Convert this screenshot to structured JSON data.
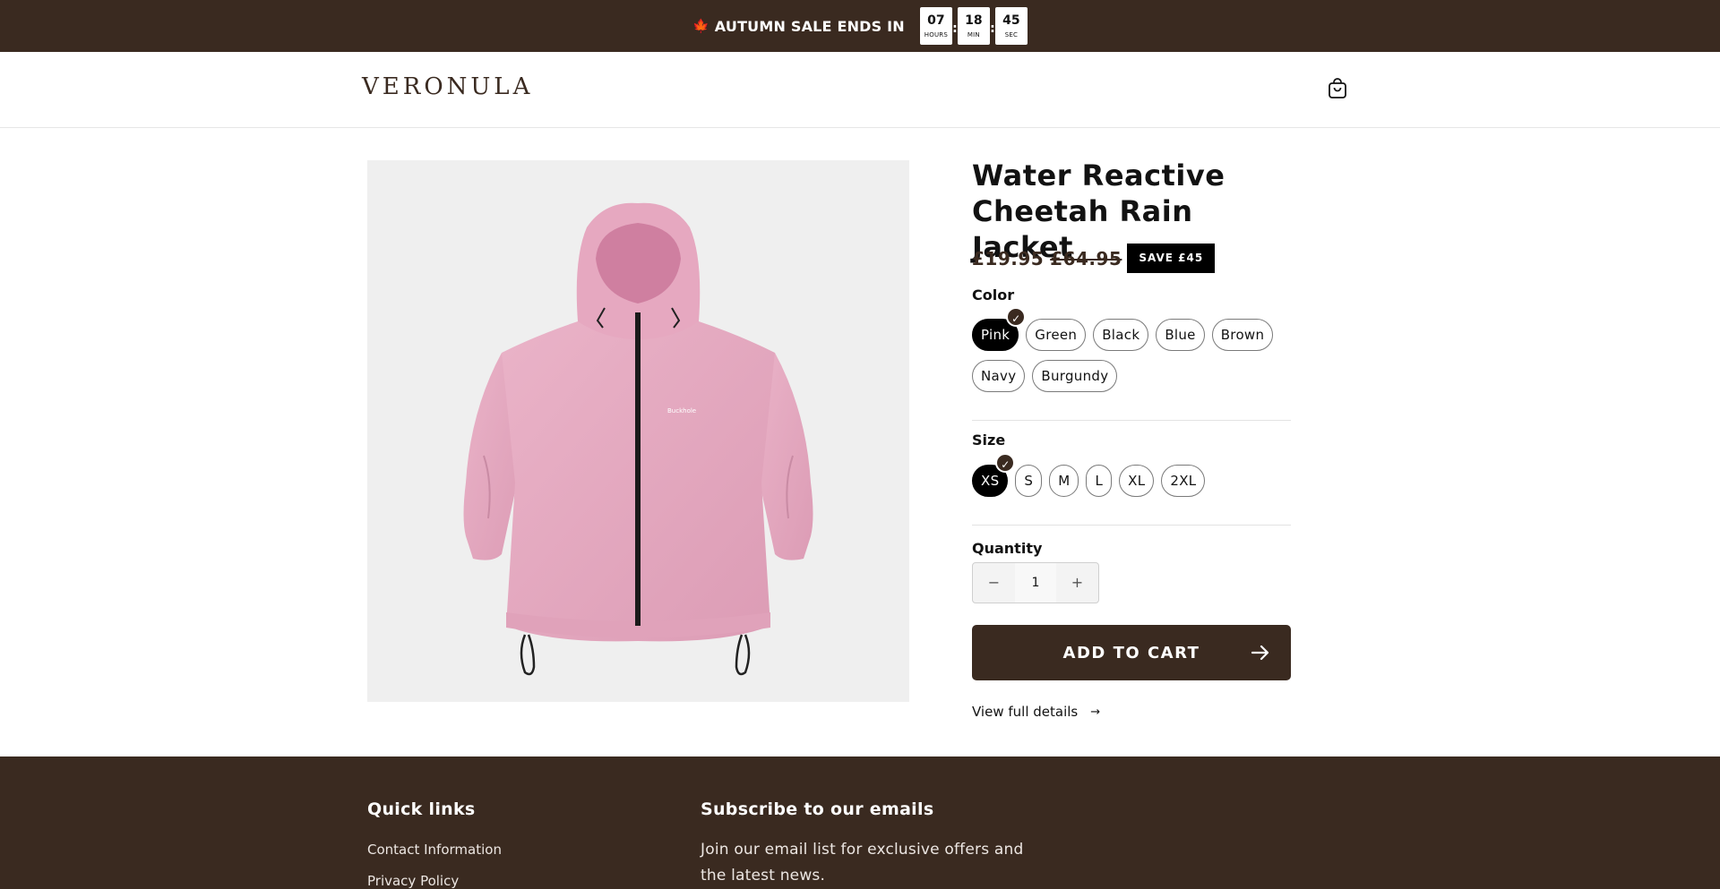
{
  "announcement": {
    "text": "AUTUMN SALE ENDS IN",
    "leaf_icon": "maple-leaf-icon",
    "timer": [
      {
        "value": "07",
        "unit": "HOURS"
      },
      {
        "value": "18",
        "unit": "MIN"
      },
      {
        "value": "45",
        "unit": "SEC"
      }
    ],
    "separator": ":"
  },
  "header": {
    "logo": "VERONULA",
    "cart_icon": "shopping-bag-icon"
  },
  "product": {
    "title": "Water Reactive Cheetah Rain Jacket",
    "price": "£19.95",
    "compare_price": "£64.95",
    "save_badge": "SAVE £45",
    "jacket_chest_text": "Buckhole",
    "color_label": "Color",
    "colors": [
      "Pink",
      "Green",
      "Black",
      "Blue",
      "Brown",
      "Navy",
      "Burgundy"
    ],
    "selected_color": "Pink",
    "size_label": "Size",
    "sizes": [
      "XS",
      "S",
      "M",
      "L",
      "XL",
      "2XL"
    ],
    "selected_size": "XS",
    "quantity_label": "Quantity",
    "quantity": "1",
    "minus": "−",
    "plus": "+",
    "add_to_cart": "ADD TO CART",
    "view_details": "View full details",
    "view_details_arrow": "→",
    "check_mark": "✓"
  },
  "footer": {
    "quick_links_heading": "Quick links",
    "links": [
      "Contact Information",
      "Privacy Policy"
    ],
    "subscribe_heading": "Subscribe to our emails",
    "subscribe_text": "Join our email list for exclusive offers and the latest news."
  },
  "colors": {
    "brand_brown": "#3a2a20",
    "product_pink": "#e5a8bf",
    "media_bg": "#efefef"
  }
}
